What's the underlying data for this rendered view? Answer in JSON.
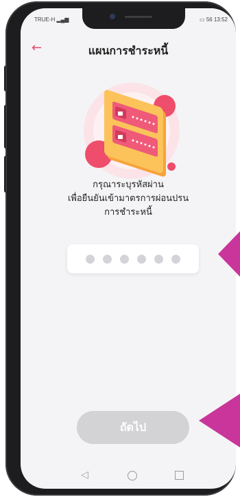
{
  "status_bar": {
    "carrier": "TRUE-H",
    "battery": "56",
    "time": "13:52"
  },
  "header": {
    "back_icon": "arrow-left-icon",
    "title": "แผนการชำระหนี้"
  },
  "illustration": {
    "icon": "password-card-lock-illustration"
  },
  "prompt": {
    "line1": "กรุณาระบุรหัสผ่าน",
    "line2": "เพื่อยืนยันเข้ามาตรการผ่อนปรน",
    "line3": "การชำระหนี้"
  },
  "pin": {
    "length": 6,
    "filled": 0
  },
  "next_button": {
    "label": "ถัดไป",
    "enabled": false
  },
  "nav": {
    "back_icon": "triangle-back-icon",
    "home_icon": "circle-home-icon",
    "recent_icon": "square-recent-icon"
  },
  "colors": {
    "accent": "#e14b6c",
    "pointer": "#c9359a",
    "disabled": "#d3d3d6"
  }
}
